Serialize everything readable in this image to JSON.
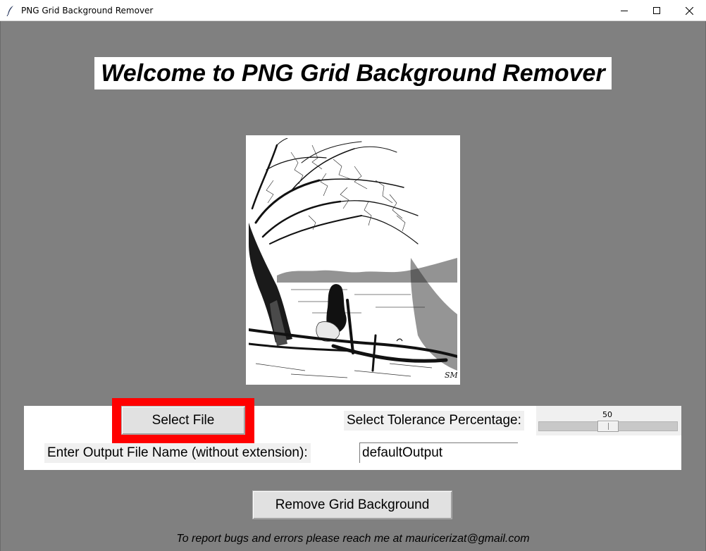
{
  "window": {
    "title": "PNG Grid Background Remover",
    "controls": [
      "minimize-icon",
      "maximize-icon",
      "close-icon"
    ]
  },
  "heading": "Welcome to PNG Grid Background Remover",
  "preview": {
    "description_icon": "image-preview",
    "signature": "SM"
  },
  "controls": {
    "select_file_label": "Select File",
    "tolerance_label": "Select Tolerance Percentage:",
    "tolerance_value": "50",
    "tolerance_fraction": 0.5,
    "output_label": "Enter Output File Name (without extension):",
    "output_value": "defaultOutput"
  },
  "actions": {
    "remove_label": "Remove Grid Background"
  },
  "footer": "To report bugs and errors please reach me at mauricerizat@gmail.com",
  "colors": {
    "background": "#808080",
    "highlight": "#ff0000",
    "panel": "#ffffff"
  }
}
